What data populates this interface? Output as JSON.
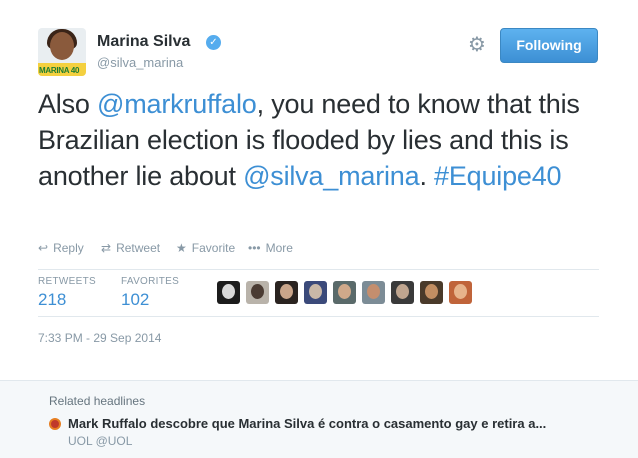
{
  "tweet": {
    "author": {
      "name": "Marina Silva",
      "handle": "@silva_marina",
      "avatar_tag": "MARINA 40"
    },
    "follow_button_label": "Following",
    "text_parts": [
      {
        "text": "Also ",
        "type": "text"
      },
      {
        "text": "@markruffalo",
        "type": "mention"
      },
      {
        "text": ", you need to know that this Brazilian election is flooded by lies and this is another lie about ",
        "type": "text"
      },
      {
        "text": "@silva_marina",
        "type": "mention"
      },
      {
        "text": ". ",
        "type": "text"
      },
      {
        "text": "#Equipe40",
        "type": "hashtag"
      }
    ],
    "actions": {
      "reply": "Reply",
      "retweet": "Retweet",
      "favorite": "Favorite",
      "more": "More"
    },
    "stats": {
      "retweets_label": "RETWEETS",
      "retweets_value": "218",
      "favorites_label": "FAVORITES",
      "favorites_value": "102"
    },
    "timestamp": "7:33 PM - 29 Sep 2014"
  },
  "favoriters": [
    {
      "bg": "#1c1c1c",
      "face": "#d9d9d9"
    },
    {
      "bg": "#b9b3aa",
      "face": "#4a3b33"
    },
    {
      "bg": "#2a2320",
      "face": "#caa58a"
    },
    {
      "bg": "#3b4a7a",
      "face": "#c9b8a8"
    },
    {
      "bg": "#5a6a6a",
      "face": "#d0a98a"
    },
    {
      "bg": "#7c8c96",
      "face": "#c48e6e"
    },
    {
      "bg": "#3a3a3a",
      "face": "#bfa58f"
    },
    {
      "bg": "#4a3a2a",
      "face": "#c28e62"
    },
    {
      "bg": "#c0643a",
      "face": "#e7b48c"
    }
  ],
  "related": {
    "title": "Related headlines",
    "headline": "Mark Ruffalo descobre que Marina Silva é contra o casamento gay e retira a...",
    "source": "UOL @UOL"
  },
  "colors": {
    "link": "#3d8fd4",
    "muted": "#8899a6",
    "button": "#4f9fde",
    "verified": "#55acee"
  }
}
